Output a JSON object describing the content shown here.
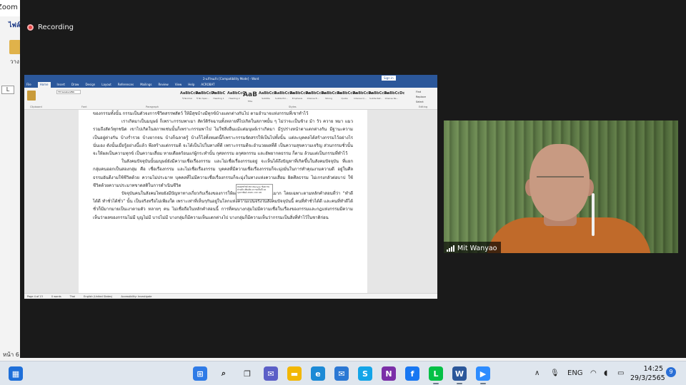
{
  "background_app": {
    "tab_label": "ไฟล์",
    "icon_label": "วาง",
    "ruler_label": "L",
    "status_text": "หน้า 6"
  },
  "zoom": {
    "window_title": "Zoom Meeting",
    "recording_label": "Recording",
    "window_controls": {
      "minimize": "—",
      "maximize": "☐",
      "close": "✕"
    },
    "participant_name": "Mit Wanyao"
  },
  "word": {
    "title": "2-แก้ไขแล้ว [Compatibility Mode] - Word",
    "sign_in": "Sign in",
    "tabs": [
      "File",
      "Home",
      "Insert",
      "Draw",
      "Design",
      "Layout",
      "References",
      "Mailings",
      "Review",
      "View",
      "Help",
      "ACROBAT"
    ],
    "active_tab": "Home",
    "tell_me": "Tell me what you want to do",
    "share": "Share",
    "font_name": "TH SarabunPSK",
    "group_labels": {
      "clipboard": "Clipboard",
      "font": "Font",
      "paragraph": "Paragraph",
      "styles": "Styles",
      "editing": "Editing"
    },
    "clipboard": {
      "cut": "Cut",
      "copy": "Copy",
      "format_painter": "Format Painter"
    },
    "styles": [
      {
        "sample": "AaBbCcDc",
        "name": "¶ Normal"
      },
      {
        "sample": "AaBbCcDc",
        "name": "¶ No Spac..."
      },
      {
        "sample": "AaBbC",
        "name": "Heading 1"
      },
      {
        "sample": "AaBbCcC",
        "name": "Heading 2"
      },
      {
        "sample": "AaB",
        "name": "Title"
      },
      {
        "sample": "AaBbCcD",
        "name": "Subtitle"
      },
      {
        "sample": "AaBbCcDc",
        "name": "Subtle Em..."
      },
      {
        "sample": "AaBbCcDc",
        "name": "Emphasis"
      },
      {
        "sample": "AaBbCcDc",
        "name": "Intense E..."
      },
      {
        "sample": "AaBbCcDc",
        "name": "Strong"
      },
      {
        "sample": "AaBbCcDc",
        "name": "Quote"
      },
      {
        "sample": "AaBbCcDc",
        "name": "Intense Q..."
      },
      {
        "sample": "AaBbCcDc",
        "name": "Subtle Ref..."
      },
      {
        "sample": "AaBbCcDc",
        "name": "Intense Re..."
      }
    ],
    "editing": {
      "find": "Find",
      "replace": "Replace",
      "select": "Select"
    },
    "paragraphs": [
      "ของกรรมทั้งนั้น กรรมเป็นตัวจงการชีวิตสรรพสัตว์ ให้มีสุขบ้างมีทุกข์บ้างแตกต่างกันไป ตามอำนาจแห่งกรรมที่เขาทำไว้",
      "เราเกิดมาเป็นมนุษย์ ก็เพราะกรรมพาเมา สัตว์ดิรัจฉานทั้งหลายที่ไปเกิดในสภาพนั้น ๆ ไม่ว่าจะเป็นช้าง ม้า วัว ควาย หมา แมว รวมถึงสัตว์ทุกชนิด เขาไปเกิดในสภาพเช่นนั้นก็เพราะกรรมพาไป ไม่ใช่สิ่งอื่นแม้แต่มนุษย์เราเกิดมา มีรูปร่างหน้าตาแตกต่างกัน มีฐานะความเป็นอยู่ต่างกัน บ้างร่ำรวย บ้างยากจน บ้างก็ฉลาดรู้ บ้างก็โง่ทั้งหมดนี้ก็เพราะกรรมจัดสรรให้เป็นไปทั้งนั้น แต่ละบุคคลได้สร้างกรรมไว้อย่างไรนั่นเอง ดังนั้นเมื่อรู้อย่างนี้แล้ว พึงสร้างแต่กรรมดี จะได้เป็นไปในทางที่ดี เพราะกรรมดีจะอำนวยผลที่ดี เป็นความสุขความเจริญ ส่วนกรรมชั่วนั้น จะให้ผลเป็นความทุกข์ เป็นความเสื่อม หายเดือดร้อนแก่ผู้กระทำนั้น กุศลกรรม อกุศลกรรม และอัพยากตธรรม ก็ตาม ล้วนแต่เป็นกรรมที่ทำไว้",
      "ในสังคมปัจจุบันนั้นมนุษย์ยังมีความเชื่อเรื่องกรรม และไม่เชื่อเรื่องกรรมอยู่ จะเห็นได้ถึงปัญหาที่เกิดขึ้นในสังคมปัจจุบัน ที่แยกกลุ่มคนออกเป็นสองกลุ่ม คือ เชื่อเรื่องกรรม และไม่เชื่อเรื่องกรรม บุคคลที่มีความเชื่อเรื่องกรรมก็จะมุ่งมั่นในการทำคุณงามความดี อยู่ในศีลธรรมอันดีงามใช้ชีวิตด้วย ความไม่ประมาท บุคคลที่ไม่มีความเชื่อเรื่องกรรมก็จะมุ่งในทางแห่งความเสื่อม ผิดศีลธรรม ไม่เกรงกลัวต่อบาป ใช้ชีวิตด้วยความประมาทขาดสติในการดำเนินชีวิต",
      "ปัจจุบันคนในสังคมไทยยังมีปัญหาทางเกี่ยวกับเรื่องของการให้ผลของกรรมอยู่จำนวนมาก โดยเฉพาะตามหลักคำสอนที่ว่า “ทำดีได้ดี ทำชั่วได้ชั่ว” นั้น เป็นจริงหรือไม่เพียงใด เพราะเท่าที่เห็นๆกันอยู่ในโลกแห่งความเป็นจริงในสังคมปัจจุบันนี้ คนที่ทำชั่วได้ดี และคนที่ทำดีได้ชั่วก็มีมากมายเป็นเงาตามตัว หลายๆ คน ไม่เชื่อถือในหลักคำสอนนี้ การที่คนบางกลุ่มไม่มีความเชื่อในเรื่องของกรรมและกฎแห่งกรรมมีความเห็นว่าผลของกรรมไม่มี บุญไม่มี บาปไม่มี บางกลุ่มก็มีความเห็นแตกต่างไป บางกลุ่มก็มีความเห็นว่ากรรมเป็นสิ่งที่ทำไว้ในชาติก่อน"
    ],
    "comment_popup": "ทองสุขรักษ์ Mit Wanyao ข้อความ ส่วนตัว เพิ่มเติม ความเห็นที่ 16 กุมภาพันธ์ 2565 เวลา 08",
    "status_bar": [
      "Page 4 of 13",
      "0 words",
      "Thai",
      "English (United States)",
      "Accessibility: Investigate"
    ]
  },
  "taskbar": {
    "apps": [
      {
        "name": "widgets",
        "glyph": "▦",
        "color": "#1e6fd9"
      },
      {
        "name": "start",
        "glyph": "⊞",
        "color": "#2f7be6"
      },
      {
        "name": "search",
        "glyph": "⌕",
        "color": "#222222"
      },
      {
        "name": "task-view",
        "glyph": "❐",
        "color": "#333333"
      },
      {
        "name": "chat",
        "glyph": "✉",
        "color": "#5b5fc7"
      },
      {
        "name": "file-explorer",
        "glyph": "▬",
        "color": "#f2b705"
      },
      {
        "name": "edge",
        "glyph": "e",
        "color": "#1c8ad6"
      },
      {
        "name": "mail",
        "glyph": "✉",
        "color": "#2b78d4"
      },
      {
        "name": "skype",
        "glyph": "S",
        "color": "#13a4e8"
      },
      {
        "name": "onenote",
        "glyph": "N",
        "color": "#7b2fa8"
      },
      {
        "name": "facebook",
        "glyph": "f",
        "color": "#1877f2"
      },
      {
        "name": "line",
        "glyph": "L",
        "color": "#05c046"
      },
      {
        "name": "word",
        "glyph": "W",
        "color": "#2b579a"
      },
      {
        "name": "zoom",
        "glyph": "▶",
        "color": "#2d8cff"
      }
    ],
    "tray": {
      "chevron": "∧",
      "language": "ENG"
    },
    "time": "14:25",
    "date": "29/3/2565",
    "notification_count": "9"
  }
}
